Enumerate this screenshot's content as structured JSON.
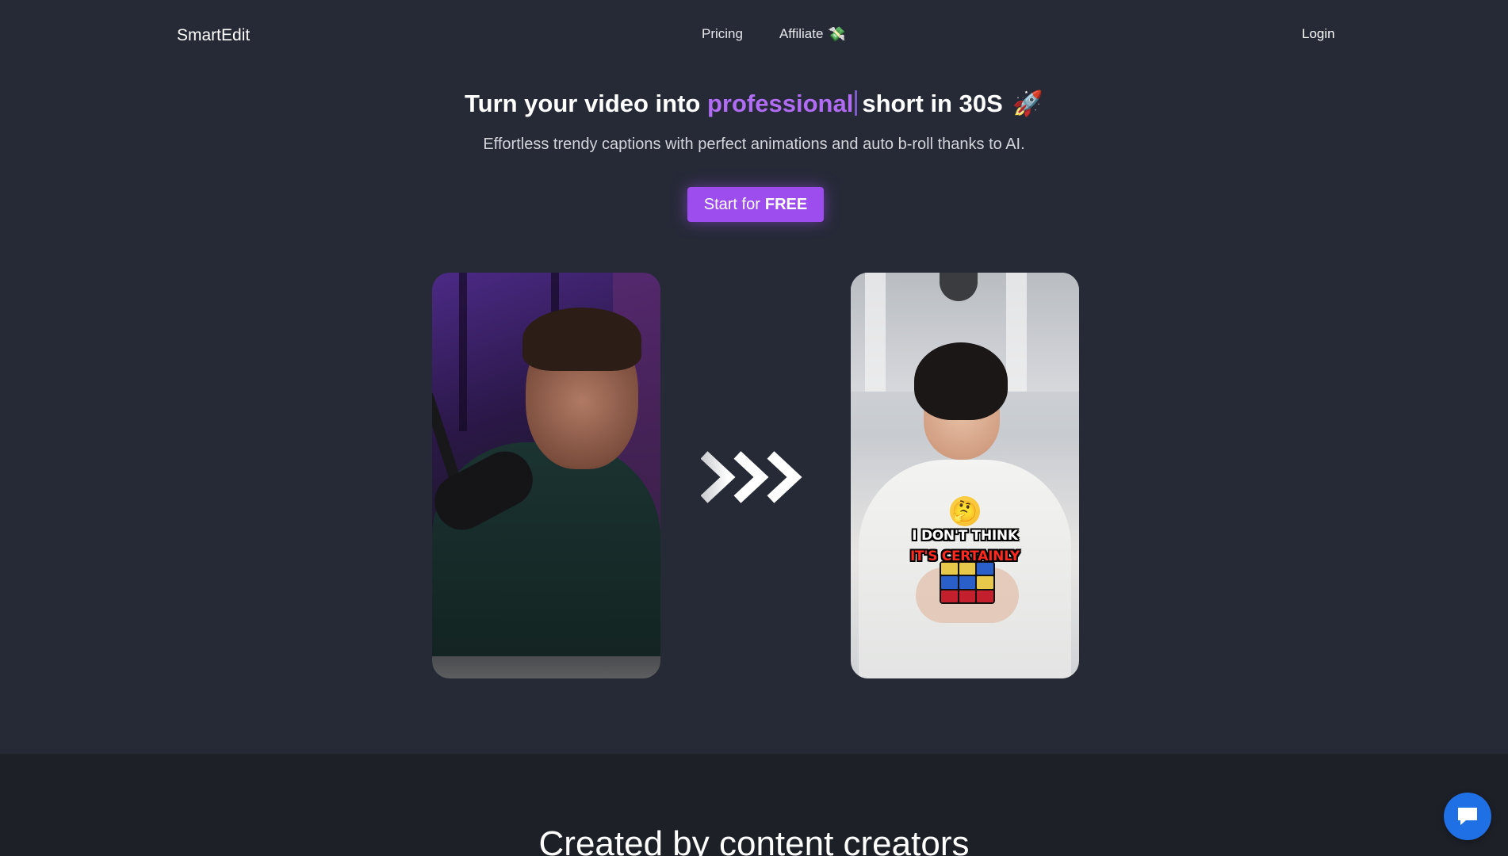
{
  "nav": {
    "brand": "SmartEdit",
    "links": [
      {
        "label": "Pricing"
      },
      {
        "label": "Affiliate",
        "icon": "money-with-wings-icon"
      }
    ],
    "login": "Login"
  },
  "hero": {
    "title_before": "Turn your video into",
    "title_accent": "professional",
    "title_after": "short in 30S",
    "title_emoji": "🚀",
    "subtitle": "Effortless trendy captions with perfect animations and auto b-roll thanks to AI.",
    "cta_prefix": "Start for",
    "cta_bold": "FREE"
  },
  "demo": {
    "before_video": "podcast-host-video",
    "after_video": "edited-short-video",
    "caption_line_1": "I DON'T THINK",
    "caption_line_2": "IT'S CERTAINLY",
    "caption_emoji": "🤔",
    "arrow_icon": "triple-chevron-right-icon"
  },
  "section": {
    "title": "Created by content creators"
  },
  "colors": {
    "background": "#262a37",
    "accent": "#b06cf3",
    "cta": "#9d4ced",
    "lower_section": "#1e2028",
    "chat": "#1f6fe5",
    "caption_red": "#ff2a1f"
  }
}
